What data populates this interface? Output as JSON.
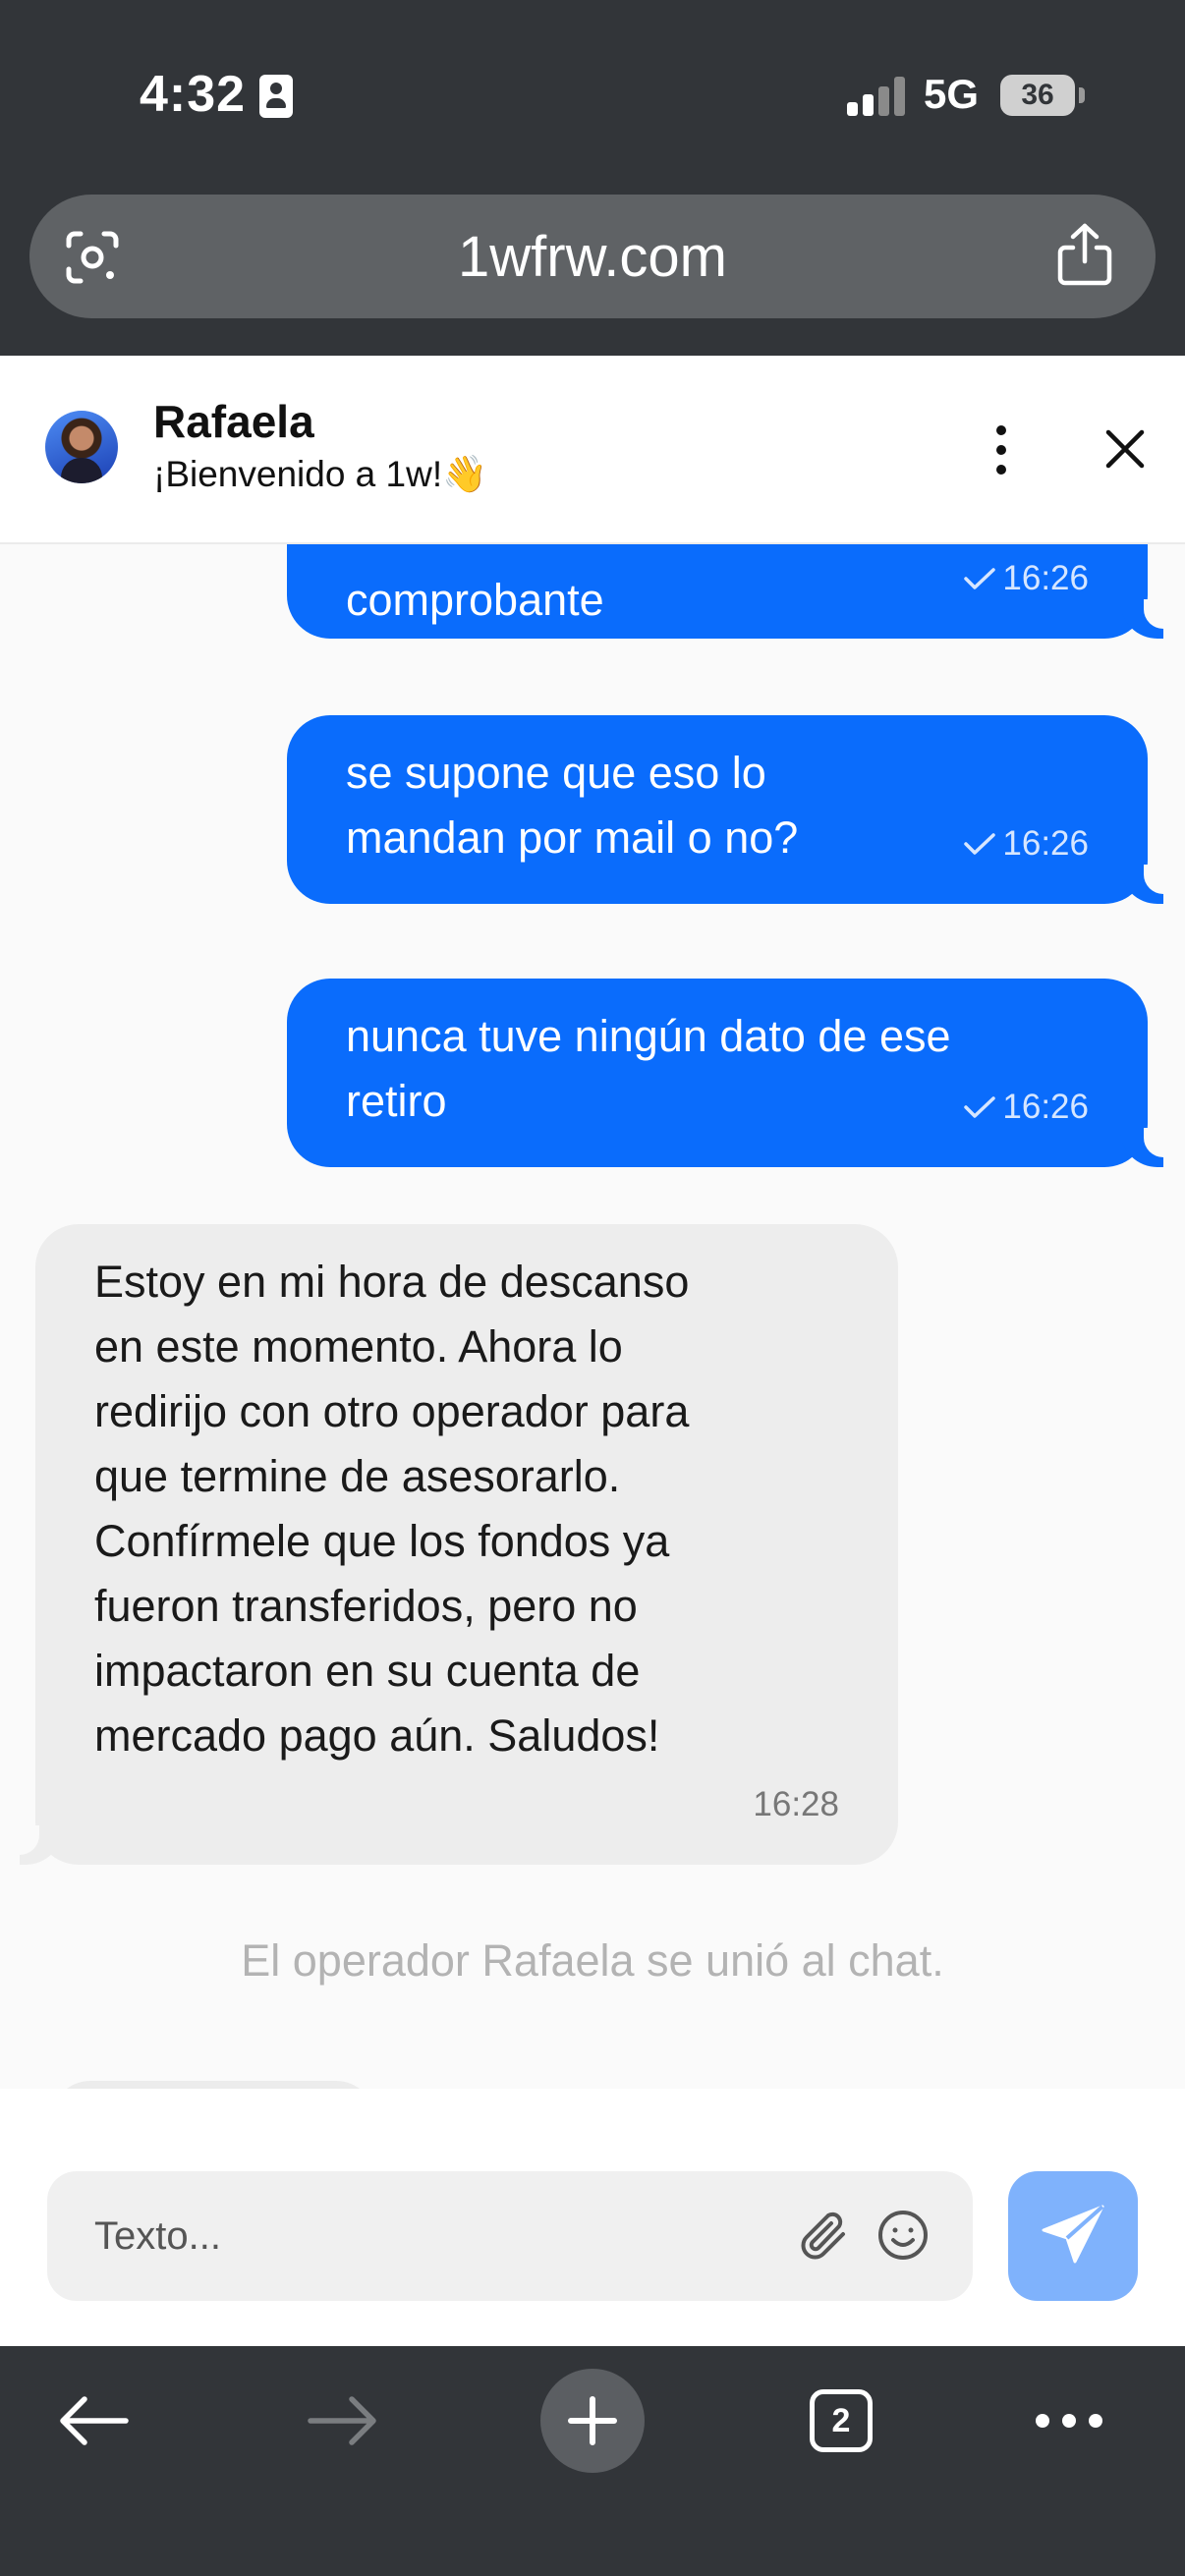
{
  "status_bar": {
    "time": "4:32",
    "network": "5G",
    "battery": "36"
  },
  "browser": {
    "url": "1wfrw.com",
    "open_tabs": "2"
  },
  "chat": {
    "contact_name": "Rafaela",
    "contact_subtitle": "¡Bienvenido a 1w!👋",
    "messages": [
      {
        "direction": "out",
        "text": "comprobante",
        "time": "16:26"
      },
      {
        "direction": "out",
        "text": "se supone que eso lo mandan por mail o no?",
        "time": "16:26"
      },
      {
        "direction": "out",
        "text": "nunca tuve ningún dato de ese retiro",
        "time": "16:26"
      },
      {
        "direction": "in",
        "text": "Estoy en mi hora de descanso en este momento. Ahora lo redirijo con otro operador para que termine de asesorarlo. Confírmele que los fondos ya fueron transferidos, pero no impactaron en su cuenta de mercado pago aún. Saludos!",
        "time": "16:28"
      }
    ],
    "system_message": "El operador Rafaela se unió al chat."
  },
  "composer": {
    "placeholder": "Texto..."
  },
  "colors": {
    "outgoing_bubble": "#0a6cfc",
    "incoming_bubble": "#ededed",
    "send_button": "#7fb2fc",
    "browser_chrome": "#323539"
  }
}
